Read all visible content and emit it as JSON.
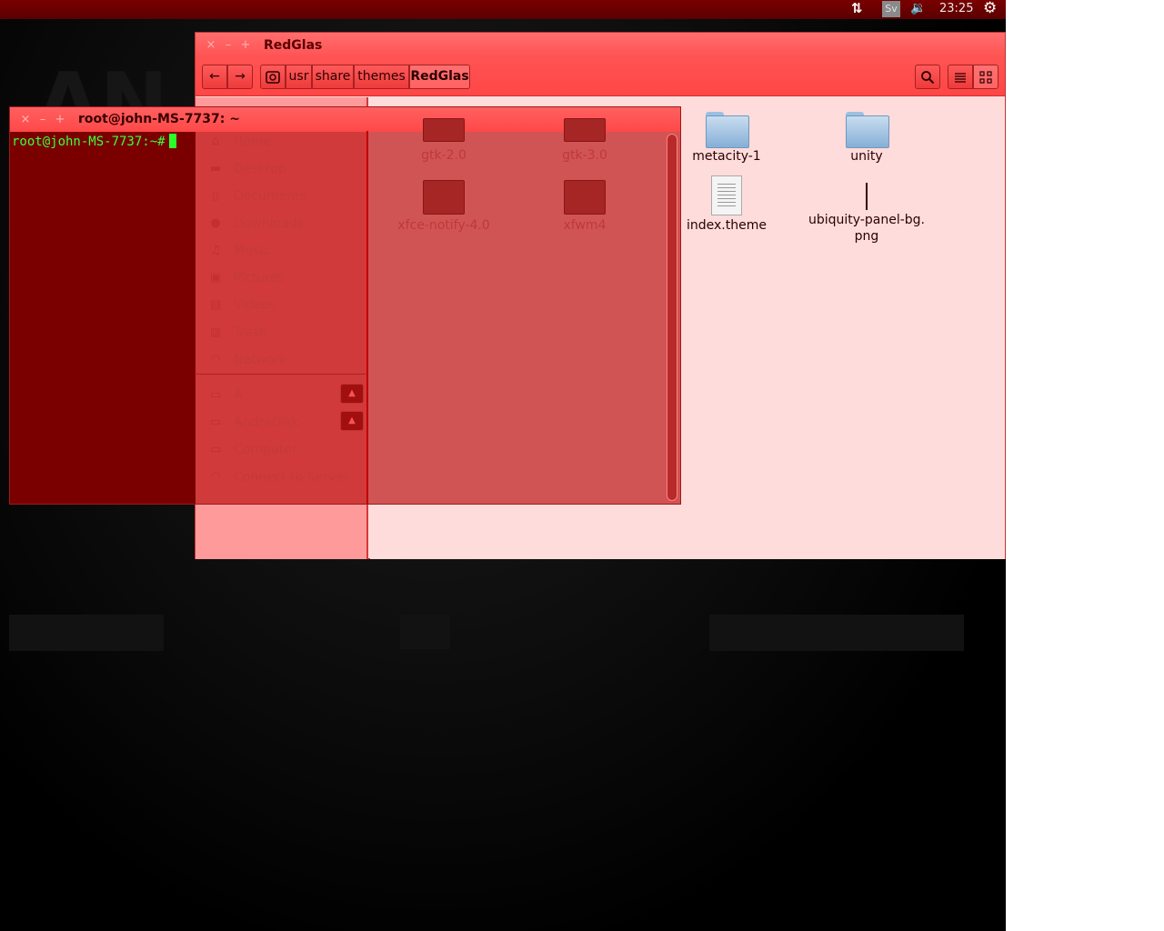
{
  "top_panel": {
    "network_icon": "network-updown-icon",
    "keyboard_layout": "Sv",
    "sound_icon": "speaker-icon",
    "clock": "23:25",
    "session_icon": "gear-icon"
  },
  "file_manager": {
    "title": "RedGlas",
    "window_buttons": {
      "close": "×",
      "minimize": "–",
      "maximize": "+"
    },
    "toolbar": {
      "back": "←",
      "forward": "→",
      "breadcrumb": [
        "usr",
        "share",
        "themes",
        "RedGlas"
      ]
    },
    "sidebar": {
      "places": [
        {
          "label": "Home",
          "icon": "home-icon"
        },
        {
          "label": "Desktop",
          "icon": "desktop-icon"
        },
        {
          "label": "Documents",
          "icon": "documents-icon"
        },
        {
          "label": "Downloads",
          "icon": "downloads-icon"
        },
        {
          "label": "Music",
          "icon": "music-icon"
        },
        {
          "label": "Pictures",
          "icon": "pictures-icon"
        },
        {
          "label": "Videos",
          "icon": "videos-icon"
        },
        {
          "label": "Trash",
          "icon": "trash-icon"
        },
        {
          "label": "Network",
          "icon": "network-icon"
        }
      ],
      "devices": [
        {
          "label": "A",
          "icon": "drive-icon",
          "eject": true
        },
        {
          "label": "AndraDisk",
          "icon": "drive-icon",
          "eject": true
        },
        {
          "label": "Computer",
          "icon": "computer-icon",
          "eject": false
        },
        {
          "label": "Connect to Server",
          "icon": "server-icon",
          "eject": false
        }
      ]
    },
    "files": [
      {
        "name": "gtk-2.0",
        "type": "folder"
      },
      {
        "name": "gtk-3.0",
        "type": "folder"
      },
      {
        "name": "metacity-1",
        "type": "folder"
      },
      {
        "name": "unity",
        "type": "folder"
      },
      {
        "name": "xfce-notify-4.0",
        "type": "folder"
      },
      {
        "name": "xfwm4",
        "type": "folder"
      },
      {
        "name": "index.theme",
        "type": "document"
      },
      {
        "name": "ubiquity-panel-bg.\npng",
        "type": "image"
      }
    ]
  },
  "terminal": {
    "title": "root@john-MS-7737: ~",
    "prompt": "root@john-MS-7737:~#"
  }
}
